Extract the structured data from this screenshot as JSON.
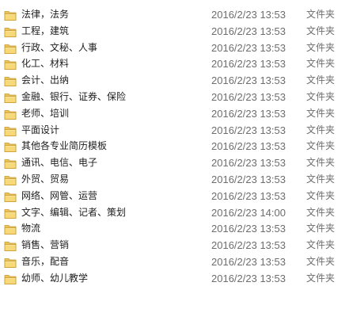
{
  "colors": {
    "folder_body": "#E8C25A",
    "folder_front": "#F7D97A",
    "folder_edge": "#C99A2E",
    "date_text": "#6D6D6D",
    "name_text": "#1E1E1E"
  },
  "files": [
    {
      "name": "法律，法务",
      "modified": "2016/2/23 13:53",
      "type": "文件夹",
      "icon": "folder-icon"
    },
    {
      "name": "工程，建筑",
      "modified": "2016/2/23 13:53",
      "type": "文件夹",
      "icon": "folder-icon"
    },
    {
      "name": "行政、文秘、人事",
      "modified": "2016/2/23 13:53",
      "type": "文件夹",
      "icon": "folder-icon"
    },
    {
      "name": "化工、材料",
      "modified": "2016/2/23 13:53",
      "type": "文件夹",
      "icon": "folder-icon"
    },
    {
      "name": "会计、出纳",
      "modified": "2016/2/23 13:53",
      "type": "文件夹",
      "icon": "folder-icon"
    },
    {
      "name": "金融、银行、证券、保险",
      "modified": "2016/2/23 13:53",
      "type": "文件夹",
      "icon": "folder-icon"
    },
    {
      "name": "老师、培训",
      "modified": "2016/2/23 13:53",
      "type": "文件夹",
      "icon": "folder-icon"
    },
    {
      "name": "平面设计",
      "modified": "2016/2/23 13:53",
      "type": "文件夹",
      "icon": "folder-icon"
    },
    {
      "name": "其他各专业简历模板",
      "modified": "2016/2/23 13:53",
      "type": "文件夹",
      "icon": "folder-icon"
    },
    {
      "name": "通讯、电信、电子",
      "modified": "2016/2/23 13:53",
      "type": "文件夹",
      "icon": "folder-icon"
    },
    {
      "name": "外贸、贸易",
      "modified": "2016/2/23 13:53",
      "type": "文件夹",
      "icon": "folder-icon"
    },
    {
      "name": "网络、网管、运营",
      "modified": "2016/2/23 13:53",
      "type": "文件夹",
      "icon": "folder-icon"
    },
    {
      "name": "文字、编辑、记者、策划",
      "modified": "2016/2/23 14:00",
      "type": "文件夹",
      "icon": "folder-icon"
    },
    {
      "name": "物流",
      "modified": "2016/2/23 13:53",
      "type": "文件夹",
      "icon": "folder-icon"
    },
    {
      "name": "销售、营销",
      "modified": "2016/2/23 13:53",
      "type": "文件夹",
      "icon": "folder-icon"
    },
    {
      "name": "音乐，配音",
      "modified": "2016/2/23 13:53",
      "type": "文件夹",
      "icon": "folder-icon"
    },
    {
      "name": "幼师、幼儿教学",
      "modified": "2016/2/23 13:53",
      "type": "文件夹",
      "icon": "folder-icon"
    }
  ]
}
